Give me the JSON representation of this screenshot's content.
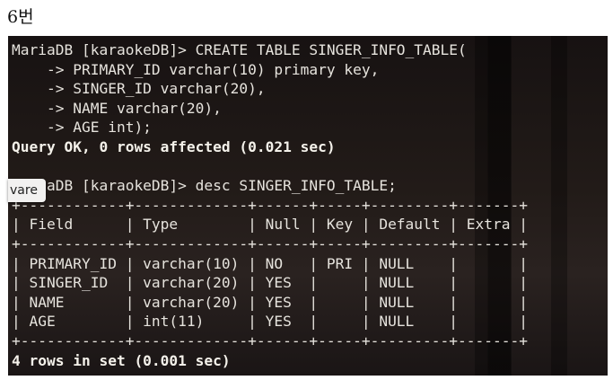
{
  "heading": "6번",
  "terminal": {
    "lines": [
      "MariaDB [karaokeDB]> CREATE TABLE SINGER_INFO_TABLE(",
      "    -> PRIMARY_ID varchar(10) primary key,",
      "    -> SINGER_ID varchar(20),",
      "    -> NAME varchar(20),",
      "    -> AGE int);",
      "Query OK, 0 rows affected (0.021 sec)",
      "",
      "MariaDB [karaokeDB]> desc SINGER_INFO_TABLE;",
      "+------------+-------------+------+-----+---------+-------+",
      "| Field      | Type        | Null | Key | Default | Extra |",
      "+------------+-------------+------+-----+---------+-------+",
      "| PRIMARY_ID | varchar(10) | NO   | PRI | NULL    |       |",
      "| SINGER_ID  | varchar(20) | YES  |     | NULL    |       |",
      "| NAME       | varchar(20) | YES  |     | NULL    |       |",
      "| AGE        | int(11)     | YES  |     | NULL    |       |",
      "+------------+-------------+------+-----+---------+-------+",
      "4 rows in set (0.001 sec)"
    ],
    "bold_lines": [
      5,
      16
    ]
  },
  "tooltip": "vare"
}
